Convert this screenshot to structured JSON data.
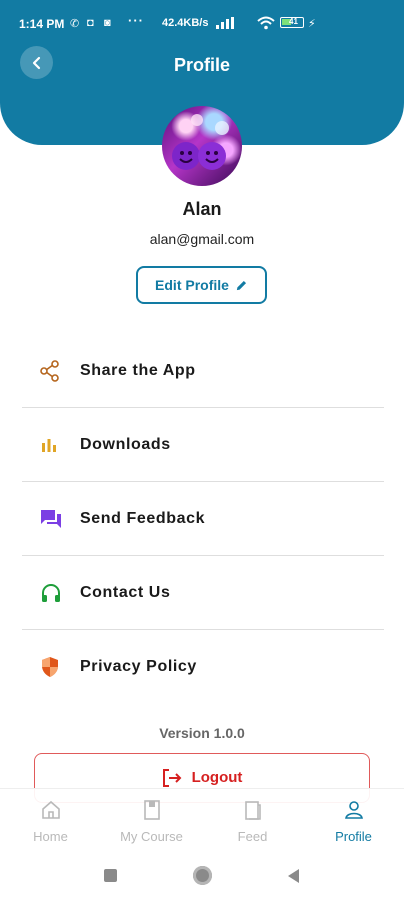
{
  "status_bar": {
    "time": "1:14 PM",
    "network_speed": "42.4KB/s",
    "dots": "···",
    "battery": "41"
  },
  "header": {
    "title": "Profile",
    "color": "#127ba3"
  },
  "profile": {
    "name": "Alan",
    "email": "alan@gmail.com",
    "edit_label": "Edit Profile"
  },
  "menu": [
    {
      "label": "Share the App",
      "icon": "share-icon",
      "color": "#b5651d"
    },
    {
      "label": "Downloads",
      "icon": "bar-chart-icon",
      "color": "#e0a526"
    },
    {
      "label": "Send Feedback",
      "icon": "feedback-icon",
      "color": "#7b3fe4"
    },
    {
      "label": "Contact Us",
      "icon": "headphones-icon",
      "color": "#1e9e3a"
    },
    {
      "label": "Privacy Policy",
      "icon": "shield-icon",
      "color": "#e0571a"
    }
  ],
  "version": "Version 1.0.0",
  "logout_label": "Logout",
  "bottom_nav": [
    {
      "label": "Home",
      "icon": "home-icon",
      "active": false
    },
    {
      "label": "My Course",
      "icon": "book-icon",
      "active": false
    },
    {
      "label": "Feed",
      "icon": "feed-icon",
      "active": false
    },
    {
      "label": "Profile",
      "icon": "person-icon",
      "active": true
    }
  ]
}
